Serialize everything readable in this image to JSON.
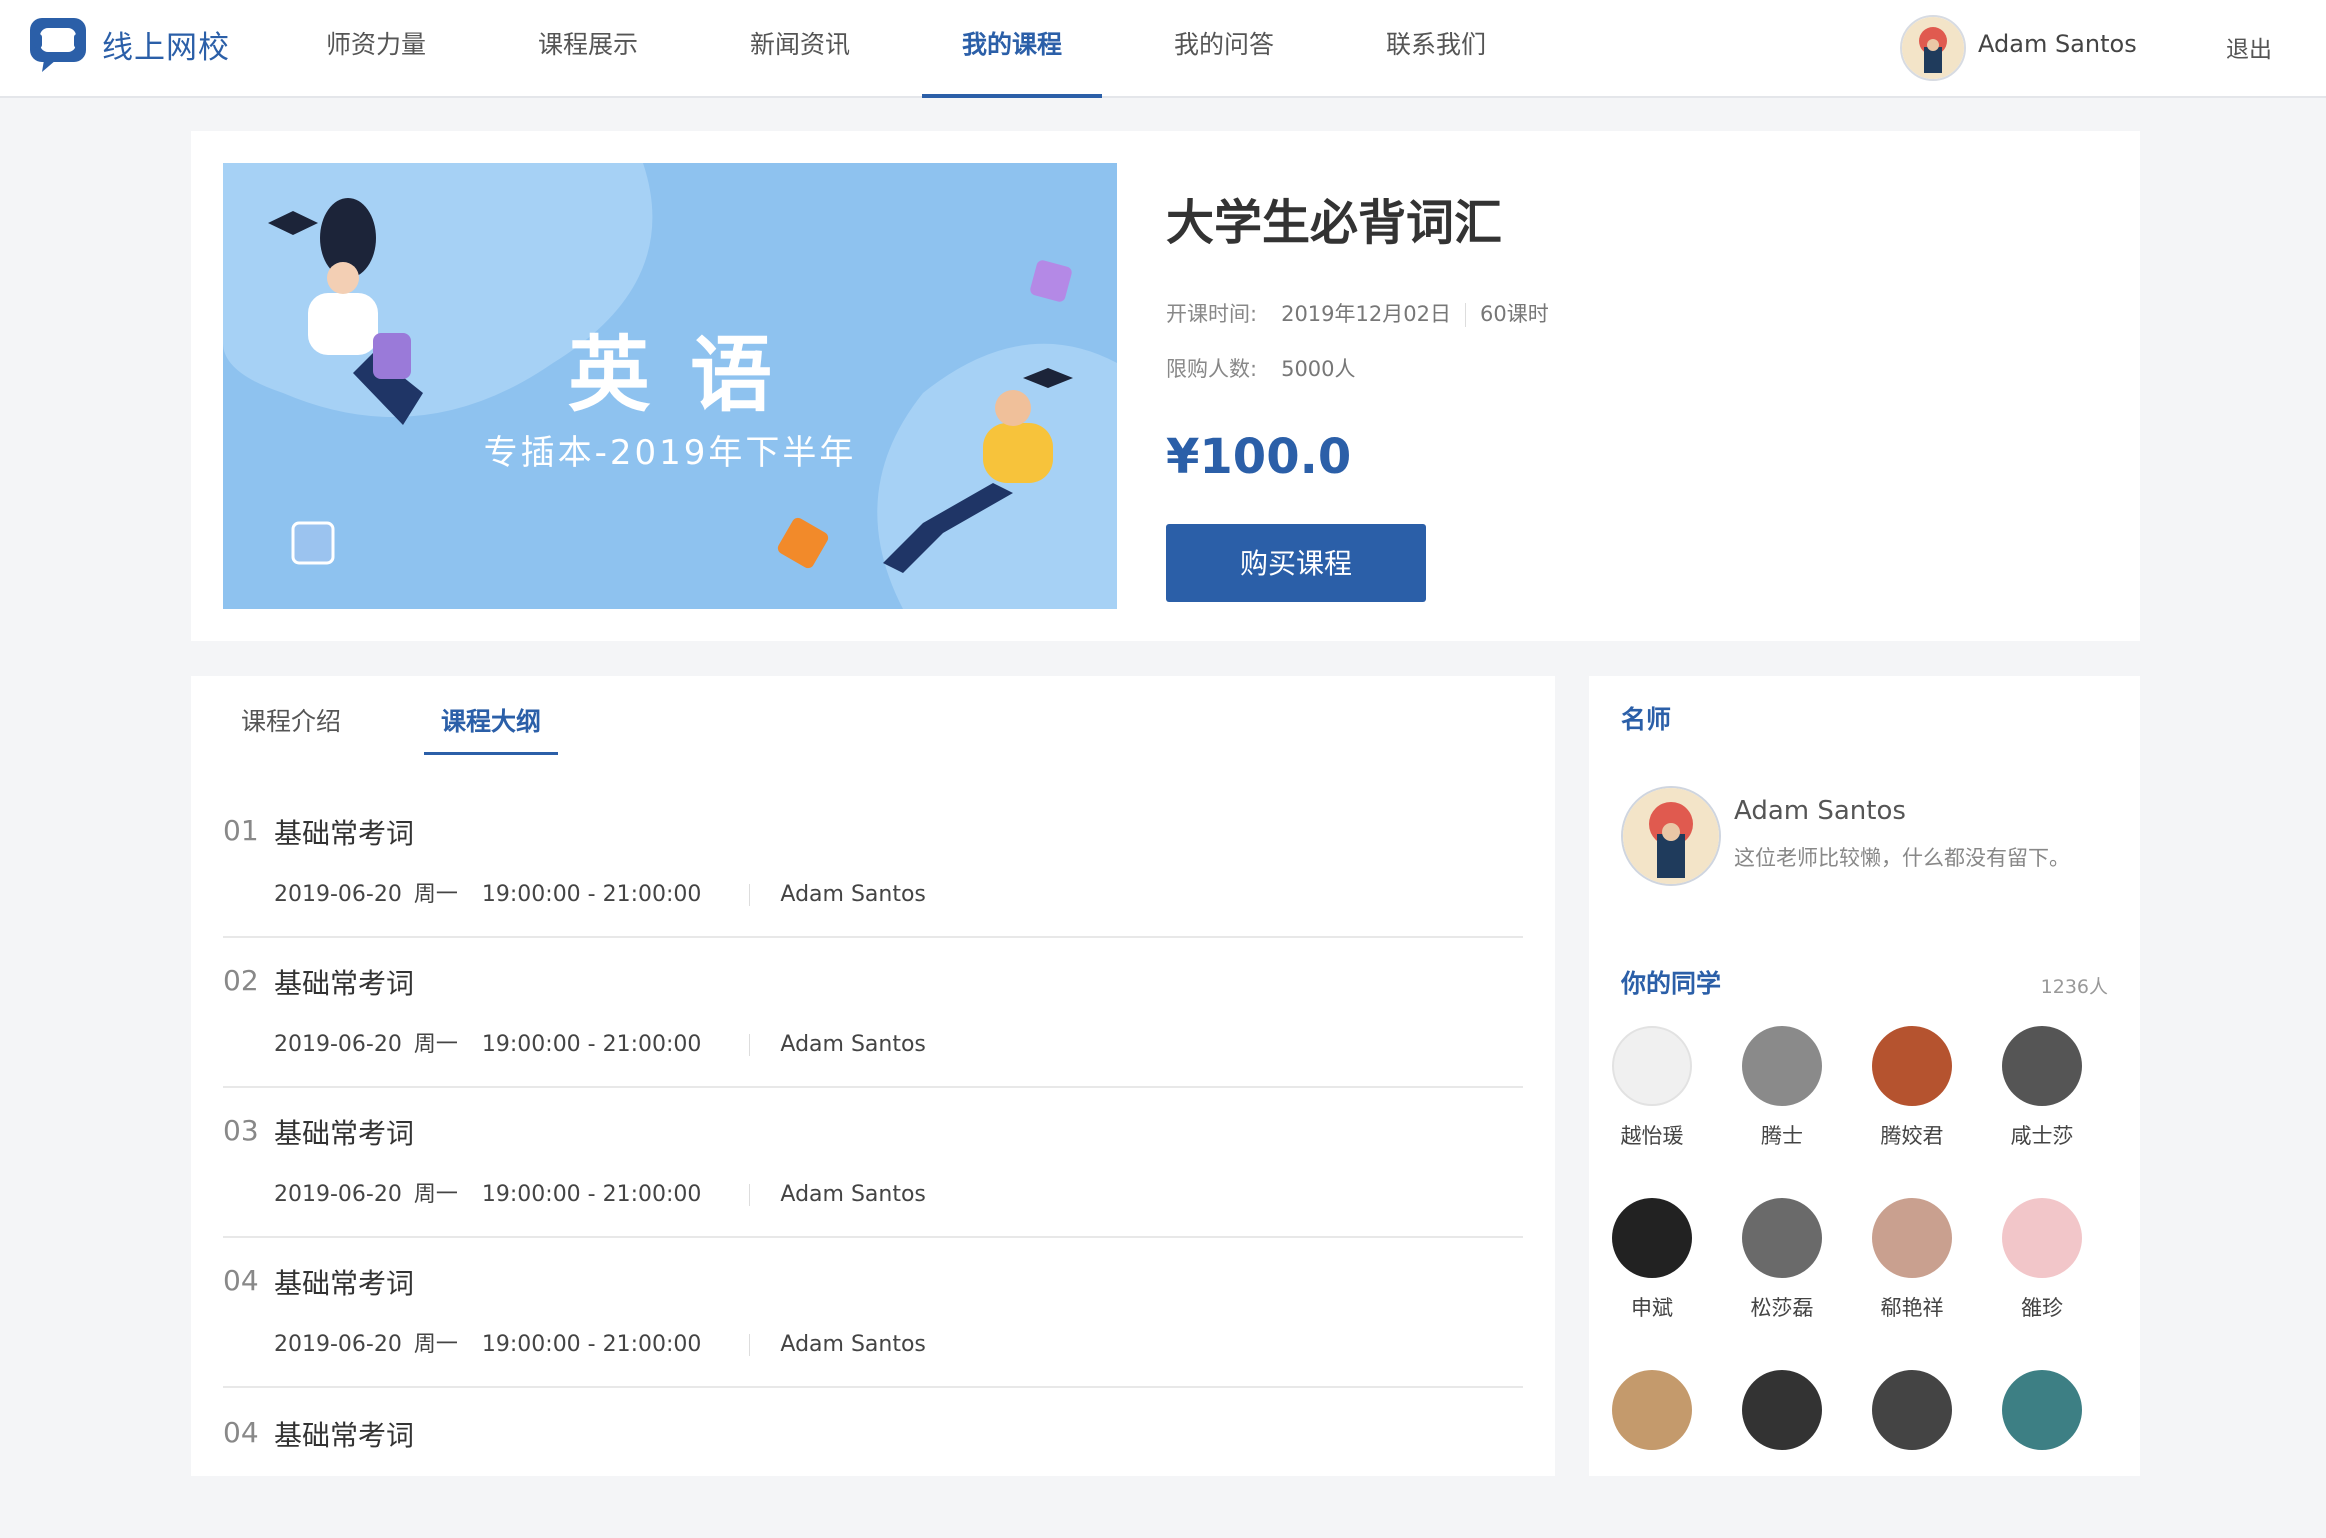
{
  "header": {
    "logo_text": "线上网校",
    "nav": [
      {
        "label": "师资力量",
        "active": false
      },
      {
        "label": "课程展示",
        "active": false
      },
      {
        "label": "新闻资讯",
        "active": false
      },
      {
        "label": "我的课程",
        "active": true
      },
      {
        "label": "我的问答",
        "active": false
      },
      {
        "label": "联系我们",
        "active": false
      }
    ],
    "user_name": "Adam Santos",
    "logout_label": "退出"
  },
  "course": {
    "banner_title": "英语",
    "banner_subtitle": "专插本-2019年下半年",
    "title": "大学生必背词汇",
    "start_label": "开课时间:",
    "start_value": "2019年12月02日",
    "hours": "60课时",
    "limit_label": "限购人数:",
    "limit_value": "5000人",
    "price": "¥100.0",
    "buy_label": "购买课程"
  },
  "tabs": [
    {
      "label": "课程介绍",
      "active": false
    },
    {
      "label": "课程大纲",
      "active": true
    }
  ],
  "lessons": [
    {
      "num": "01",
      "title": "基础常考词",
      "date": "2019-06-20",
      "week": "周一",
      "time": "19:00:00 - 21:00:00",
      "teacher": "Adam Santos"
    },
    {
      "num": "02",
      "title": "基础常考词",
      "date": "2019-06-20",
      "week": "周一",
      "time": "19:00:00 - 21:00:00",
      "teacher": "Adam Santos"
    },
    {
      "num": "03",
      "title": "基础常考词",
      "date": "2019-06-20",
      "week": "周一",
      "time": "19:00:00 - 21:00:00",
      "teacher": "Adam Santos"
    },
    {
      "num": "04",
      "title": "基础常考词",
      "date": "2019-06-20",
      "week": "周一",
      "time": "19:00:00 - 21:00:00",
      "teacher": "Adam Santos"
    },
    {
      "num": "04",
      "title": "基础常考词",
      "date": "",
      "week": "",
      "time": "",
      "teacher": ""
    }
  ],
  "sidebar": {
    "teacher_heading": "名师",
    "teacher_name": "Adam Santos",
    "teacher_desc": "这位老师比较懒，什么都没有留下。",
    "classmates_heading": "你的同学",
    "classmates_count": "1236人",
    "classmates": [
      {
        "name": "越怡瑗",
        "color": "#f0f0f0"
      },
      {
        "name": "腾士",
        "color": "#8a8a8a"
      },
      {
        "name": "腾姣君",
        "color": "#b5532f"
      },
      {
        "name": "咸士莎",
        "color": "#555555"
      },
      {
        "name": "申斌",
        "color": "#222222"
      },
      {
        "name": "松莎磊",
        "color": "#6a6a6a"
      },
      {
        "name": "郗艳祥",
        "color": "#c9a08f"
      },
      {
        "name": "雒珍",
        "color": "#f2c6c9"
      },
      {
        "name": "",
        "color": "#c49a6c"
      },
      {
        "name": "",
        "color": "#333333"
      },
      {
        "name": "",
        "color": "#444444"
      },
      {
        "name": "",
        "color": "#3d7f84"
      }
    ]
  },
  "colors": {
    "accent": "#2b5fa8",
    "banner_bg": "#8ec2ef"
  }
}
